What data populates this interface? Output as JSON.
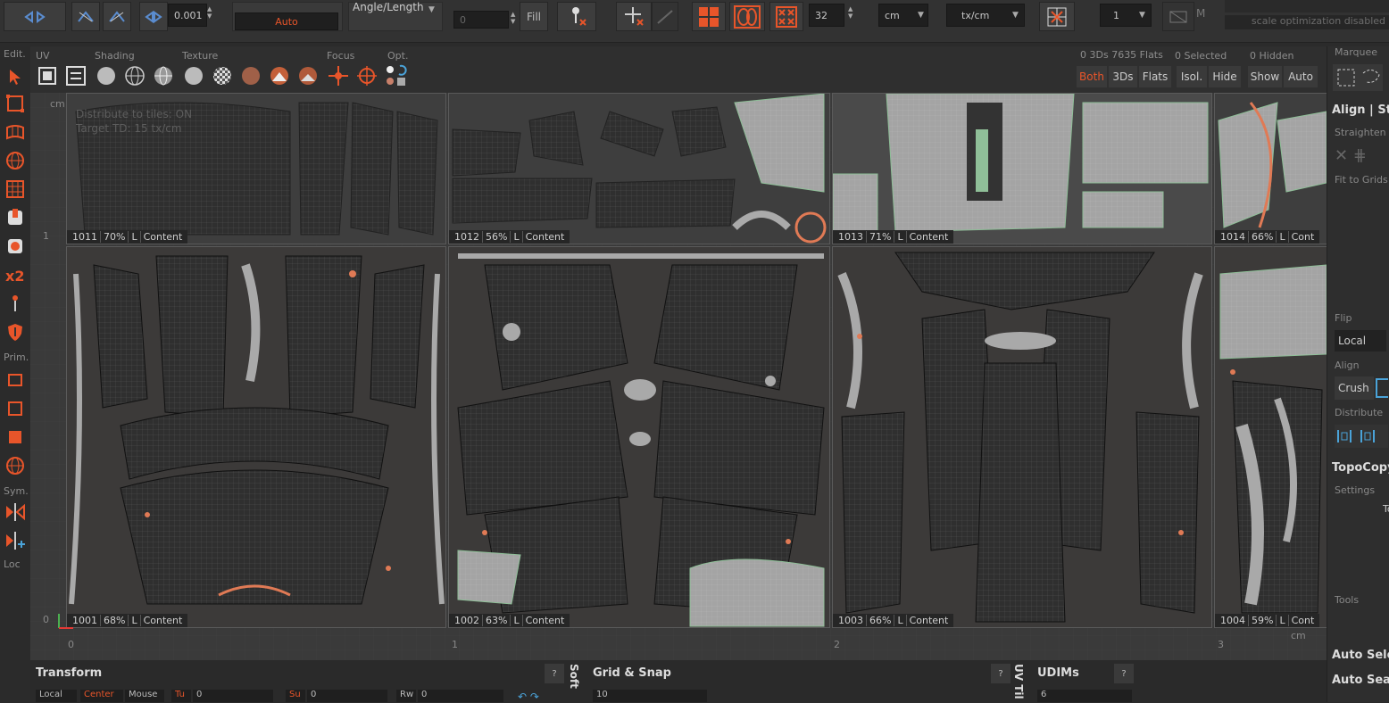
{
  "toolbar": {
    "threshold_value": "0.001",
    "auto_label": "Auto",
    "angle_length_label": "Angle/Length",
    "angle_value": "0",
    "fill_label": "Fill",
    "texel_value": "32",
    "unit_select": "cm",
    "density_select": "tx/cm",
    "udim_count": "1",
    "m_label": "M",
    "scale_status": "scale optimization disabled"
  },
  "tool_sections": {
    "edit": "Edit.",
    "uv": "UV",
    "shading": "Shading",
    "texture": "Texture",
    "focus": "Focus",
    "opt": "Opt."
  },
  "stats": {
    "summary": "0 3Ds 7635 Flats",
    "selected": "0 Selected",
    "hidden": "0 Hidden"
  },
  "view_buttons": [
    "Both",
    "3Ds",
    "Flats",
    "Isol.",
    "Hide",
    "Show",
    "Auto"
  ],
  "left_labels": {
    "prim": "Prim.",
    "sym": "Sym.",
    "loc": "Loc",
    "x2": "x2"
  },
  "viewport": {
    "overlay_line1": "Distribute to tiles: ON",
    "overlay_line2": "Target TD: 15 tx/cm",
    "corner_unit": "cm",
    "row_label_top": "1",
    "row_label_bottom": "0",
    "axis_x": [
      "0",
      "1",
      "2",
      "3"
    ],
    "axis_unit": "cm"
  },
  "tiles": [
    {
      "udim": "1011",
      "pct": "70%",
      "l": "L",
      "content": "Content"
    },
    {
      "udim": "1012",
      "pct": "56%",
      "l": "L",
      "content": "Content"
    },
    {
      "udim": "1013",
      "pct": "71%",
      "l": "L",
      "content": "Content"
    },
    {
      "udim": "1014",
      "pct": "66%",
      "l": "L",
      "content": "Cont"
    },
    {
      "udim": "1001",
      "pct": "68%",
      "l": "L",
      "content": "Content"
    },
    {
      "udim": "1002",
      "pct": "63%",
      "l": "L",
      "content": "Content"
    },
    {
      "udim": "1003",
      "pct": "66%",
      "l": "L",
      "content": "Content"
    },
    {
      "udim": "1004",
      "pct": "59%",
      "l": "L",
      "content": "Cont"
    }
  ],
  "right_panel": {
    "marquee": "Marquee",
    "align_title": "Align | Str",
    "straighten": "Straighten",
    "fit_to_grids": "Fit to Grids",
    "flip": "Flip",
    "flip_mode": "Local",
    "align": "Align",
    "crush": "Crush",
    "distribute": "Distribute",
    "topocopy": "TopoCopy",
    "settings": "Settings",
    "settings_value": "To",
    "tools": "Tools",
    "auto_select": "Auto Sele",
    "auto_search": "Auto Sear"
  },
  "bottom": {
    "transform": "Transform",
    "soft_sel": "Soft Se",
    "grid_snap": "Grid & Snap",
    "uv_tile": "UV Til",
    "udims": "UDIMs",
    "help": "?",
    "local": "Local",
    "center": "Center",
    "mouse": "Mouse",
    "tu": "Tu",
    "tu_value": "0",
    "su": "Su",
    "su_value": "0",
    "rw": "Rw",
    "rw_value": "0",
    "grid_value": "10",
    "udim_value": "6"
  },
  "colors": {
    "accent": "#e8552a",
    "island_gray": "#a9a9a9",
    "island_dark": "#3a3a3a",
    "seam_green": "#8fbf98",
    "tile_bg": "#3e3e3e"
  }
}
